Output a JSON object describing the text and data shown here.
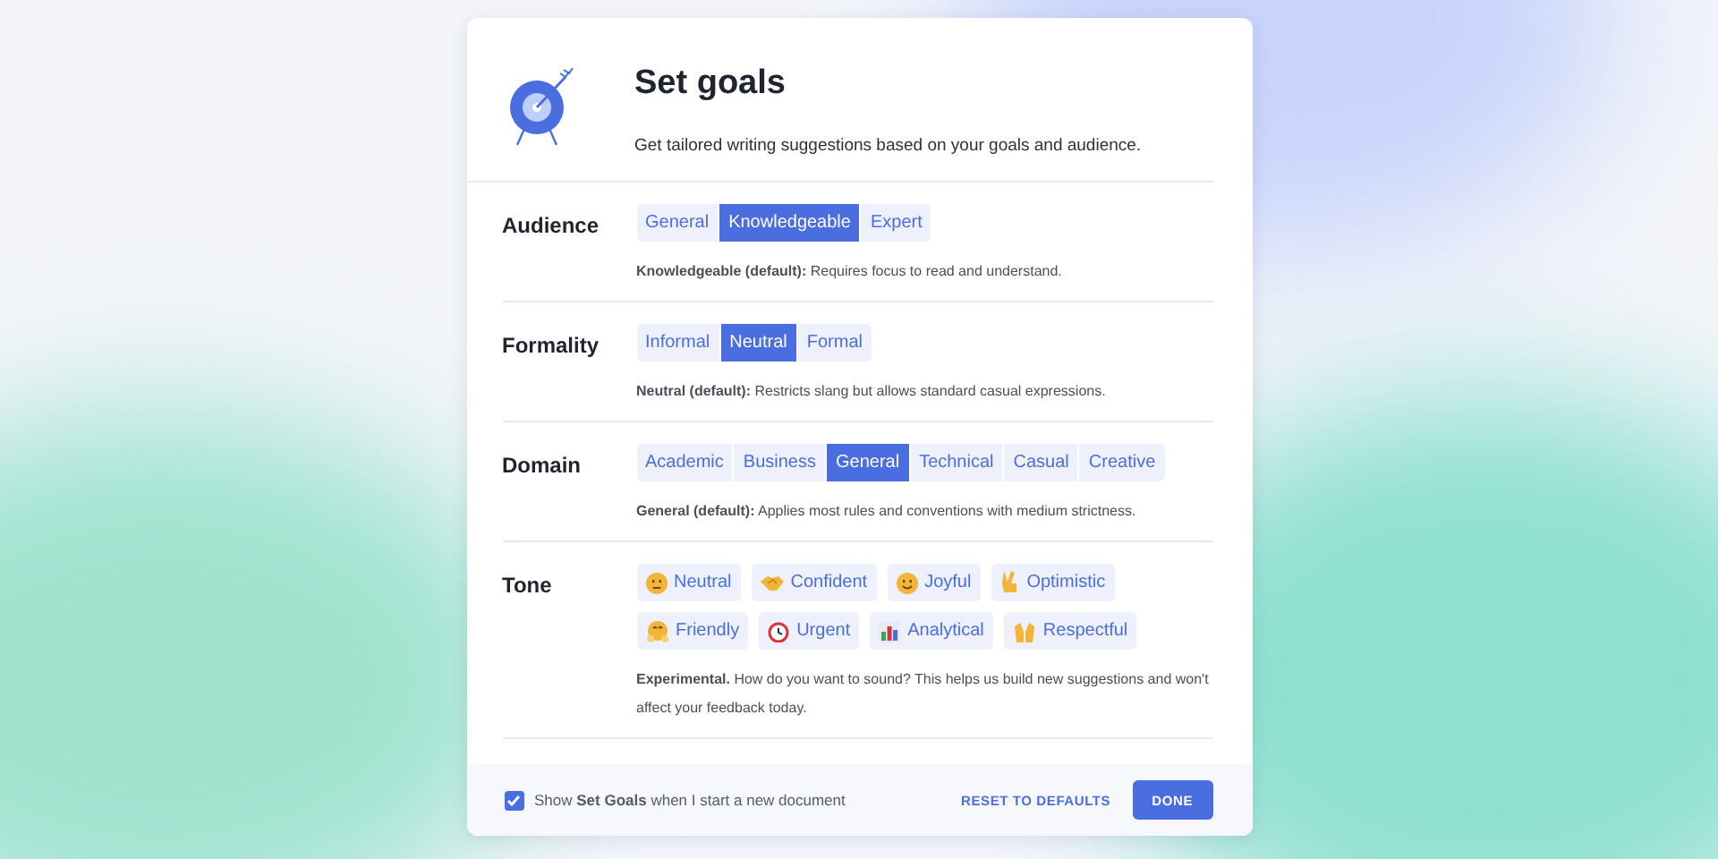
{
  "dialog": {
    "title": "Set goals",
    "subtitle": "Get tailored writing suggestions based on your goals and audience."
  },
  "sections": [
    {
      "kind": "segmented",
      "label": "Audience",
      "options": [
        {
          "label": "General",
          "selected": false
        },
        {
          "label": "Knowledgeable",
          "selected": true
        },
        {
          "label": "Expert",
          "selected": false
        }
      ],
      "description": "**Knowledgeable (default):** Requires focus to read and understand."
    },
    {
      "kind": "segmented",
      "label": "Formality",
      "options": [
        {
          "label": "Informal",
          "selected": false
        },
        {
          "label": "Neutral",
          "selected": true
        },
        {
          "label": "Formal",
          "selected": false
        }
      ],
      "description": "**Neutral (default):** Restricts slang but allows standard casual expressions."
    },
    {
      "kind": "segmented",
      "label": "Domain",
      "options": [
        {
          "label": "Academic",
          "selected": false
        },
        {
          "label": "Business",
          "selected": false
        },
        {
          "label": "General",
          "selected": true
        },
        {
          "label": "Technical",
          "selected": false
        },
        {
          "label": "Casual",
          "selected": false
        },
        {
          "label": "Creative",
          "selected": false
        }
      ],
      "description": "**General (default):** Applies most rules and conventions with medium strictness."
    },
    {
      "kind": "chips",
      "label": "Tone",
      "options": [
        {
          "label": "Neutral",
          "selected": false
        },
        {
          "label": "Confident",
          "selected": false
        },
        {
          "label": "Joyful",
          "selected": false
        },
        {
          "label": "Optimistic",
          "selected": false
        },
        {
          "label": "Friendly",
          "selected": false
        },
        {
          "label": "Urgent",
          "selected": false
        },
        {
          "label": "Analytical",
          "selected": false
        },
        {
          "label": "Respectful",
          "selected": false
        }
      ],
      "description": "**Experimental.** How do you want to sound? This helps us build new suggestions and won't affect your feedback today."
    }
  ],
  "footer": {
    "checkbox": {
      "label": "Show **Set Goals** when I start a new document",
      "checked": true
    },
    "buttons": [
      "RESET TO DEFAULTS",
      "DONE"
    ]
  }
}
